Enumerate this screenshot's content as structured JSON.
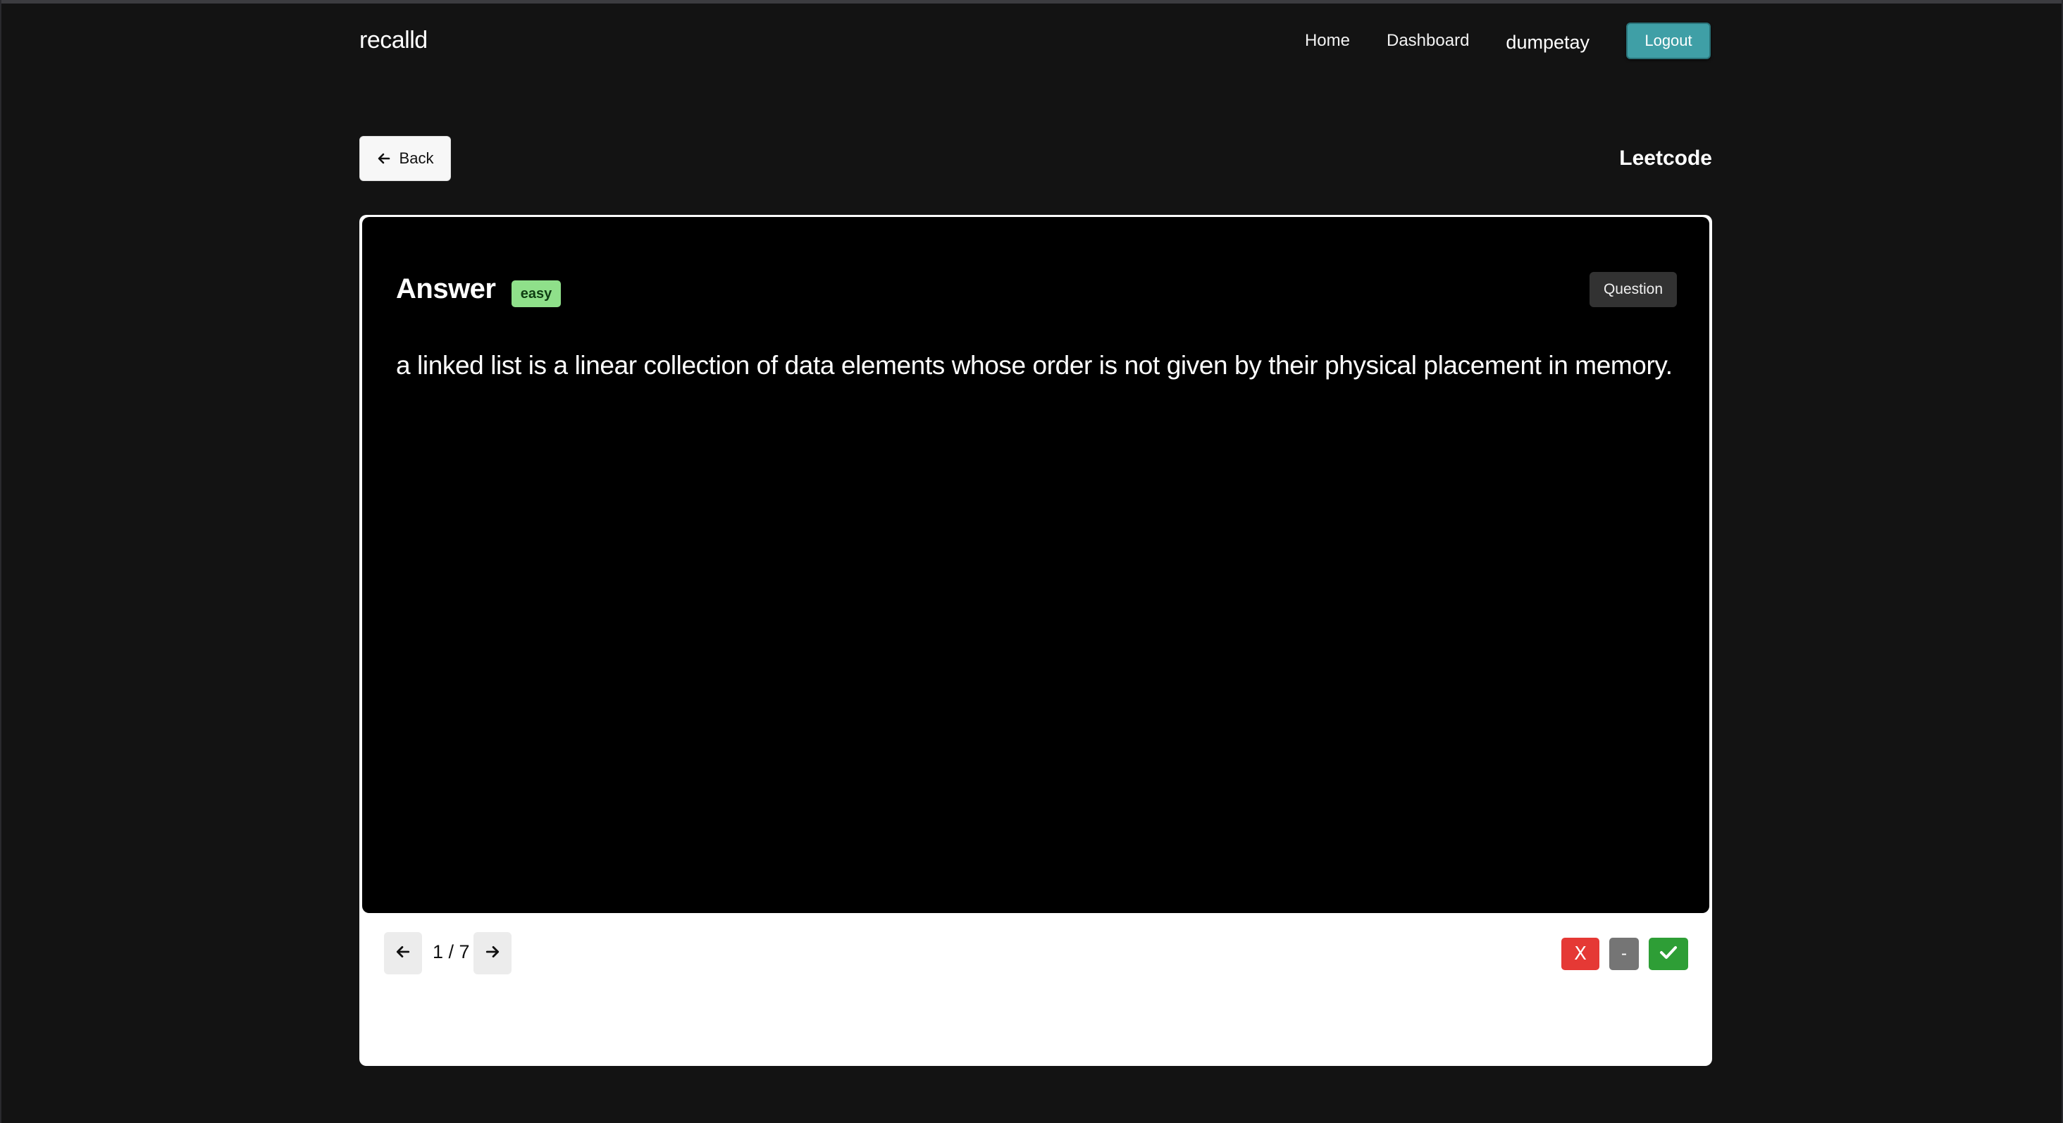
{
  "app": {
    "brand": "recalld"
  },
  "nav": {
    "home": "Home",
    "dashboard": "Dashboard",
    "username": "dumpetay",
    "logout": "Logout"
  },
  "page": {
    "back_label": "Back",
    "deck_title": "Leetcode"
  },
  "card": {
    "side_label": "Answer",
    "difficulty": "easy",
    "toggle_label": "Question",
    "text": "a linked list is a linear collection of data elements whose order is not given by their physical placement in memory."
  },
  "pager": {
    "counter": "1 / 7"
  },
  "grading": {
    "wrong_label": "X",
    "neutral_label": "-"
  },
  "colors": {
    "background": "#131313",
    "accent": "#3f9fa6",
    "badge_easy": "#8fe08a",
    "wrong": "#e53935",
    "neutral": "#757575",
    "right": "#2e9e36"
  },
  "icons": {
    "back": "arrow-left-icon",
    "prev": "arrow-left-icon",
    "next": "arrow-right-icon",
    "right": "check-icon"
  }
}
